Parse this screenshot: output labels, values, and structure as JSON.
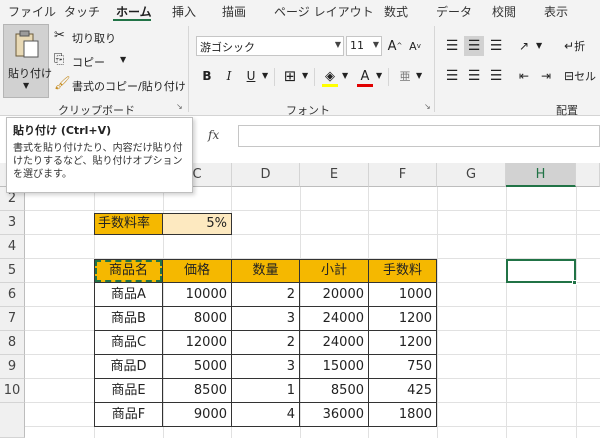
{
  "menu": {
    "tabs": [
      "ファイル",
      "タッチ",
      "ホーム",
      "挿入",
      "描画",
      "ページ レイアウト",
      "数式",
      "データ",
      "校閲",
      "表示"
    ],
    "active": "ホーム"
  },
  "ribbon": {
    "clipboard": {
      "paste_label": "貼り付け",
      "cut_label": "切り取り",
      "copy_label": "コピー",
      "format_painter_label": "書式のコピー/貼り付け",
      "group_label": "クリップボード"
    },
    "font": {
      "font_name": "游ゴシック",
      "font_size": "11",
      "grow_label": "A",
      "shrink_label": "A",
      "bold": "B",
      "italic": "I",
      "underline": "U",
      "font_color_letter": "A",
      "phonetic_label": "亜",
      "group_label": "フォント"
    },
    "alignment": {
      "wrap_label": "折",
      "merge_label": "セル",
      "group_label": "配置"
    }
  },
  "tooltip": {
    "title": "貼り付け (Ctrl+V)",
    "body": "書式を貼り付けたり、内容だけ貼り付けたりするなど、貼り付けオプションを選びます。"
  },
  "formula_bar": {
    "fx": "fx",
    "value": ""
  },
  "sheet": {
    "columns": [
      "C",
      "D",
      "E",
      "F",
      "G",
      "H"
    ],
    "selected_column": "H",
    "rows": [
      "2",
      "3",
      "4",
      "5",
      "6",
      "7",
      "8",
      "9",
      "10"
    ],
    "fee_rate_label": "手数料率",
    "fee_rate_value": "5%",
    "headers": [
      "商品名",
      "価格",
      "数量",
      "小計",
      "手数料"
    ],
    "table": [
      [
        "商品A",
        "10000",
        "2",
        "20000",
        "1000"
      ],
      [
        "商品B",
        "8000",
        "3",
        "24000",
        "1200"
      ],
      [
        "商品C",
        "12000",
        "2",
        "24000",
        "1200"
      ],
      [
        "商品D",
        "5000",
        "3",
        "15000",
        "750"
      ],
      [
        "商品E",
        "8500",
        "1",
        "8500",
        "425"
      ],
      [
        "商品F",
        "9000",
        "4",
        "36000",
        "1800"
      ]
    ]
  },
  "colors": {
    "accent": "#217346",
    "header_fill": "#f5b800",
    "rate_fill": "#fde9c0"
  }
}
